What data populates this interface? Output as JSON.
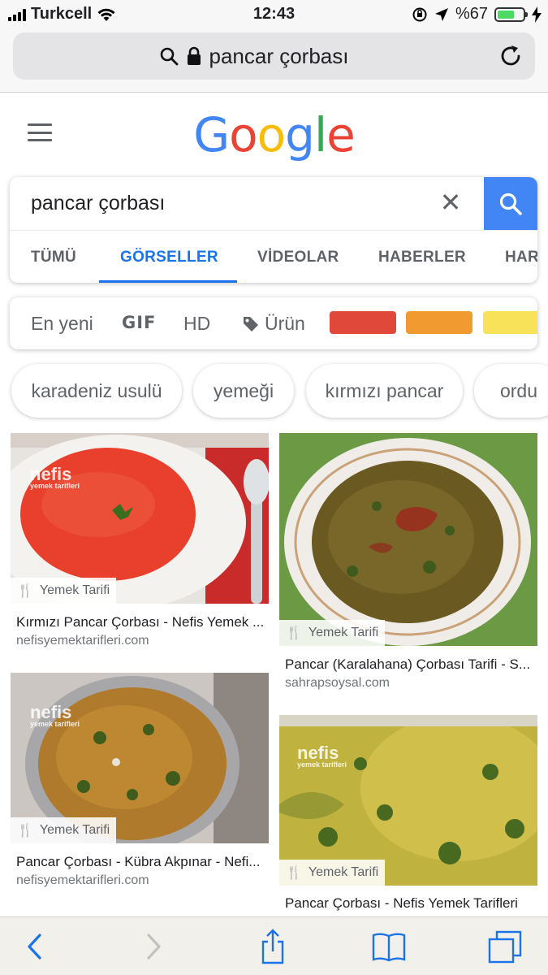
{
  "status_bar": {
    "carrier": "Turkcell",
    "time": "12:43",
    "battery_percent": "%67",
    "battery_level": 0.67,
    "colors": {
      "battery_fill": "#4cd964"
    }
  },
  "address_bar": {
    "query": "pancar çorbası",
    "icons": [
      "search-icon",
      "lock-icon",
      "reload-icon"
    ]
  },
  "google": {
    "logo": {
      "letters": [
        "G",
        "o",
        "o",
        "g",
        "l",
        "e"
      ],
      "colors": [
        "#4285f4",
        "#ea4335",
        "#fbbc05",
        "#4285f4",
        "#34a853",
        "#ea4335"
      ]
    },
    "search_value": "pancar çorbası",
    "tabs": [
      "TÜMÜ",
      "GÖRSELLER",
      "VİDEOLAR",
      "HABERLER",
      "HAR"
    ],
    "active_tab": "GÖRSELLER",
    "accent_color": "#1a73e8",
    "tools": {
      "newest": "En yeni",
      "gif": "GIF",
      "hd": "HD",
      "product": "Ürün",
      "color_swatches": [
        "#e0483a",
        "#f09a30",
        "#f7e25a"
      ]
    },
    "chips": [
      "karadeniz usulü",
      "yemeği",
      "kırmızı pancar",
      "ordu"
    ]
  },
  "results": [
    {
      "badge": "Yemek Tarifi",
      "title": "Kırmızı Pancar Çorbası - Nefis Yemek ...",
      "source": "nefisyemektarifleri.com",
      "watermark": "nefis",
      "watermark_sub": "yemek tarifleri"
    },
    {
      "badge": "Yemek Tarifi",
      "title": "Pancar (Karalahana) Çorbası Tarifi - S...",
      "source": "sahrapsoysal.com"
    },
    {
      "badge": "Yemek Tarifi",
      "title": "Pancar Çorbası - Kübra Akpınar - Nefi...",
      "source": "nefisyemektarifleri.com",
      "watermark": "nefis",
      "watermark_sub": "yemek tarifleri"
    },
    {
      "badge": "Yemek Tarifi",
      "title": "Pancar Çorbası - Nefis Yemek Tarifleri",
      "source": "",
      "watermark": "nefis",
      "watermark_sub": "yemek tarifleri"
    }
  ],
  "bottom_toolbar": {
    "icons": [
      "back-icon",
      "forward-icon",
      "share-icon",
      "bookmarks-icon",
      "tabs-icon"
    ]
  }
}
